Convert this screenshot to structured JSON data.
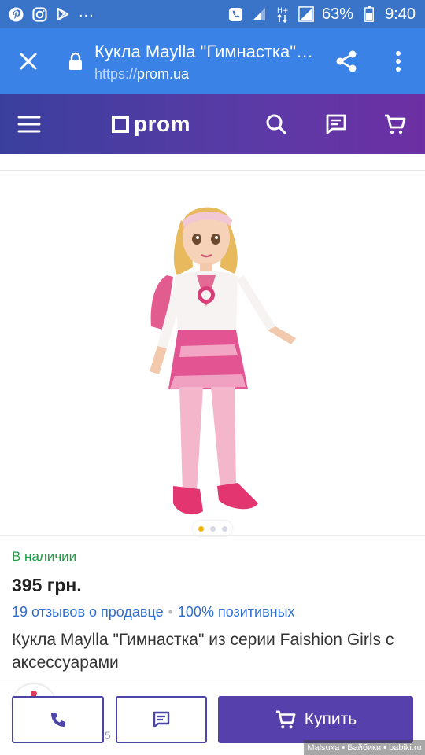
{
  "status_bar": {
    "battery": "63%",
    "time": "9:40",
    "overflow": "...",
    "icons": [
      "pinterest-icon",
      "instagram-icon",
      "play-store-icon",
      "phone-call-icon",
      "signal-icon",
      "data-ht-icon",
      "signal-icon",
      "battery-icon"
    ]
  },
  "tab_bar": {
    "title": "Кукла Maylla \"Гимнастка\" из серии Faishion Girls с аксессуарами",
    "url_scheme": "https://",
    "url_host": "prom.ua",
    "icons": [
      "close-icon",
      "lock-icon",
      "share-icon",
      "more-vert-icon"
    ]
  },
  "header": {
    "logo_text": "prom",
    "icons": [
      "menu-icon",
      "search-icon",
      "chat-icon",
      "cart-icon"
    ]
  },
  "gallery": {
    "dots_total": 3,
    "active_dot": 1
  },
  "product": {
    "availability": "В наличии",
    "price": "395 грн.",
    "reviews": "19 отзывов о продавце",
    "separator": "•",
    "positive": "100% позитивных",
    "title": "Кукла Maylla \"Гимнастка\" из серии Faishion Girls с аксессуарами"
  },
  "actions": {
    "buy_label": "Купить",
    "peek_number": "5"
  },
  "watermark": "Malsuxa • Байбики • babiki.ru",
  "colors": {
    "status_bar": "#3a74c9",
    "tab_bar": "#3b82e6",
    "header_start": "#3a3f9e",
    "header_end": "#6d2fa3",
    "availability": "#1b9e3e",
    "link": "#2f6fd0",
    "buy_button": "#5640ab",
    "active_dot": "#f5b400"
  }
}
